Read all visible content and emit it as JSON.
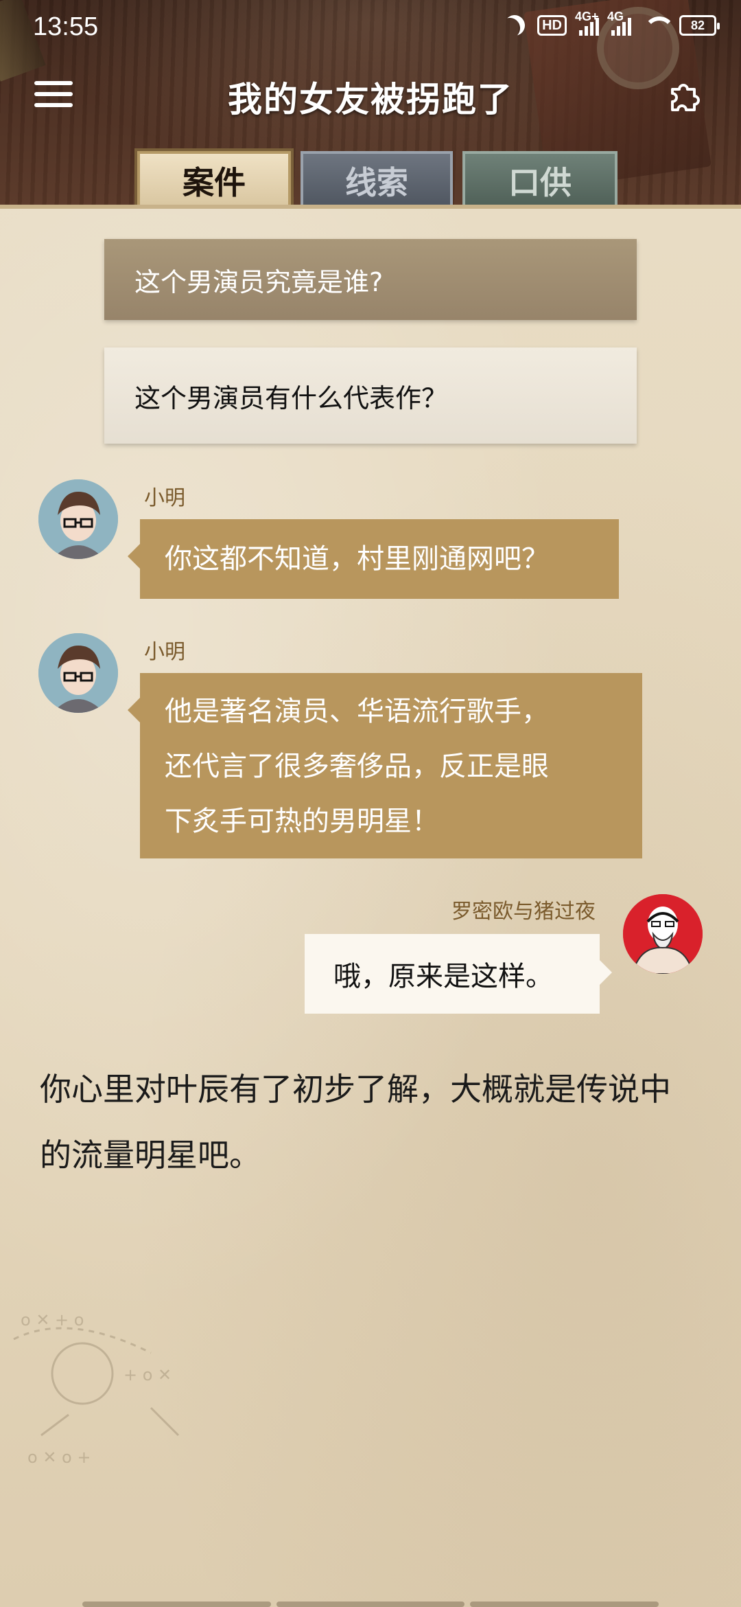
{
  "status_bar": {
    "time": "13:55",
    "hd_label": "HD",
    "signal_1": "4G+",
    "signal_2": "4G",
    "battery": "82"
  },
  "header": {
    "title": "我的女友被拐跑了",
    "menu_icon": "hamburger-icon",
    "puzzle_icon": "puzzle-icon"
  },
  "tabs": [
    {
      "label": "案件",
      "active": true
    },
    {
      "label": "线索",
      "active": false
    },
    {
      "label": "口供",
      "active": false
    }
  ],
  "choices": [
    {
      "text": "这个男演员究竟是谁?"
    },
    {
      "text": "这个男演员有什么代表作？"
    }
  ],
  "messages": [
    {
      "sender": "小明",
      "lines": [
        "你这都不知道，村里刚通网吧？"
      ]
    },
    {
      "sender": "小明",
      "lines": [
        "他是著名演员、华语流行歌手，",
        "还代言了很多奢侈品，反正是眼",
        "下炙手可热的男明星！"
      ]
    },
    {
      "sender": "罗密欧与猪过夜",
      "lines": [
        "哦，原来是这样。"
      ]
    }
  ],
  "narration": "你心里对叶辰有了初步了解，大概就是传说中的流量明星吧。",
  "colors": {
    "bubble_left": "#b8965d",
    "bubble_right": "#fbf7ef",
    "paper": "#e8dcc4",
    "sender_name": "#7a5a2c"
  }
}
